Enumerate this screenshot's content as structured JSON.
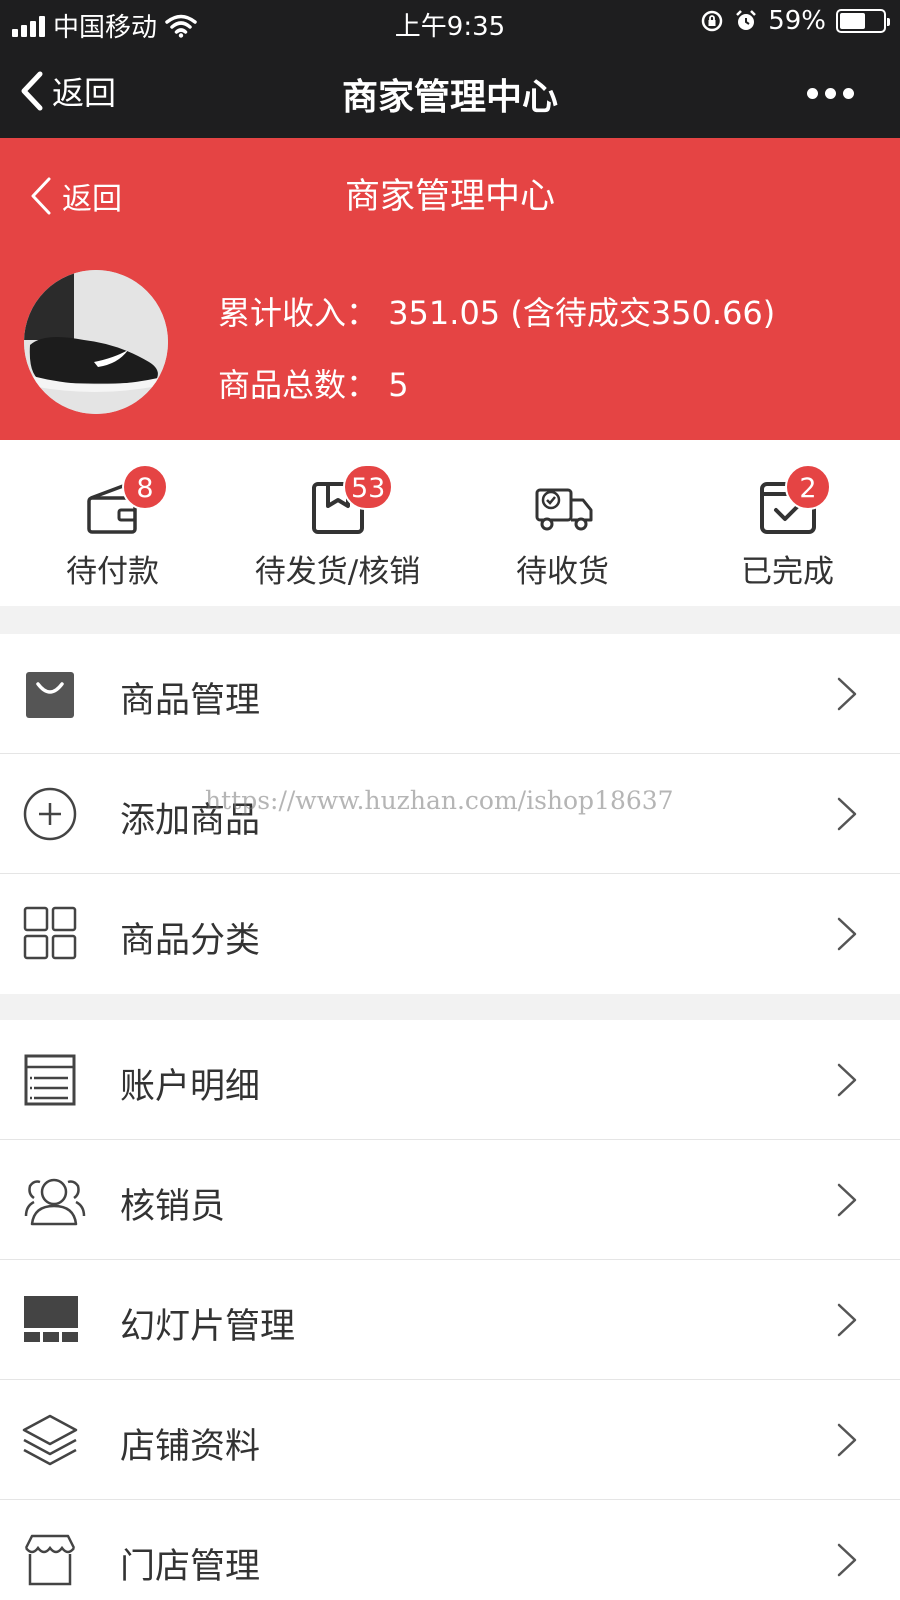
{
  "status_bar": {
    "carrier": "中国移动",
    "time": "上午9:35",
    "battery": "59%",
    "battery_level": 0.59
  },
  "nav_bar": {
    "back_label": "返回",
    "title": "商家管理中心"
  },
  "header": {
    "back_label": "返回",
    "title": "商家管理中心",
    "income_label": "累计收入：",
    "income_value": "351.05",
    "income_pending": "(含待成交350.66)",
    "product_count_label": "商品总数：",
    "product_count_value": "5"
  },
  "order_status": [
    {
      "label": "待付款",
      "badge": "8",
      "icon": "wallet-icon"
    },
    {
      "label": "待发货/核销",
      "badge": "53",
      "icon": "package-icon"
    },
    {
      "label": "待收货",
      "badge": "",
      "icon": "truck-icon"
    },
    {
      "label": "已完成",
      "badge": "2",
      "icon": "completed-icon"
    }
  ],
  "menu_group_1": [
    {
      "label": "商品管理",
      "icon": "shopping-bag-icon"
    },
    {
      "label": "添加商品",
      "icon": "plus-circle-icon"
    },
    {
      "label": "商品分类",
      "icon": "grid-icon"
    }
  ],
  "menu_group_2": [
    {
      "label": "账户明细",
      "icon": "list-icon"
    },
    {
      "label": "核销员",
      "icon": "users-icon"
    },
    {
      "label": "幻灯片管理",
      "icon": "slideshow-icon"
    },
    {
      "label": "店铺资料",
      "icon": "layers-icon"
    },
    {
      "label": "门店管理",
      "icon": "store-icon"
    }
  ],
  "watermark": "https://www.huzhan.com/ishop18637",
  "colors": {
    "brand_red": "#e54444",
    "nav_dark": "#1e1e1f"
  }
}
